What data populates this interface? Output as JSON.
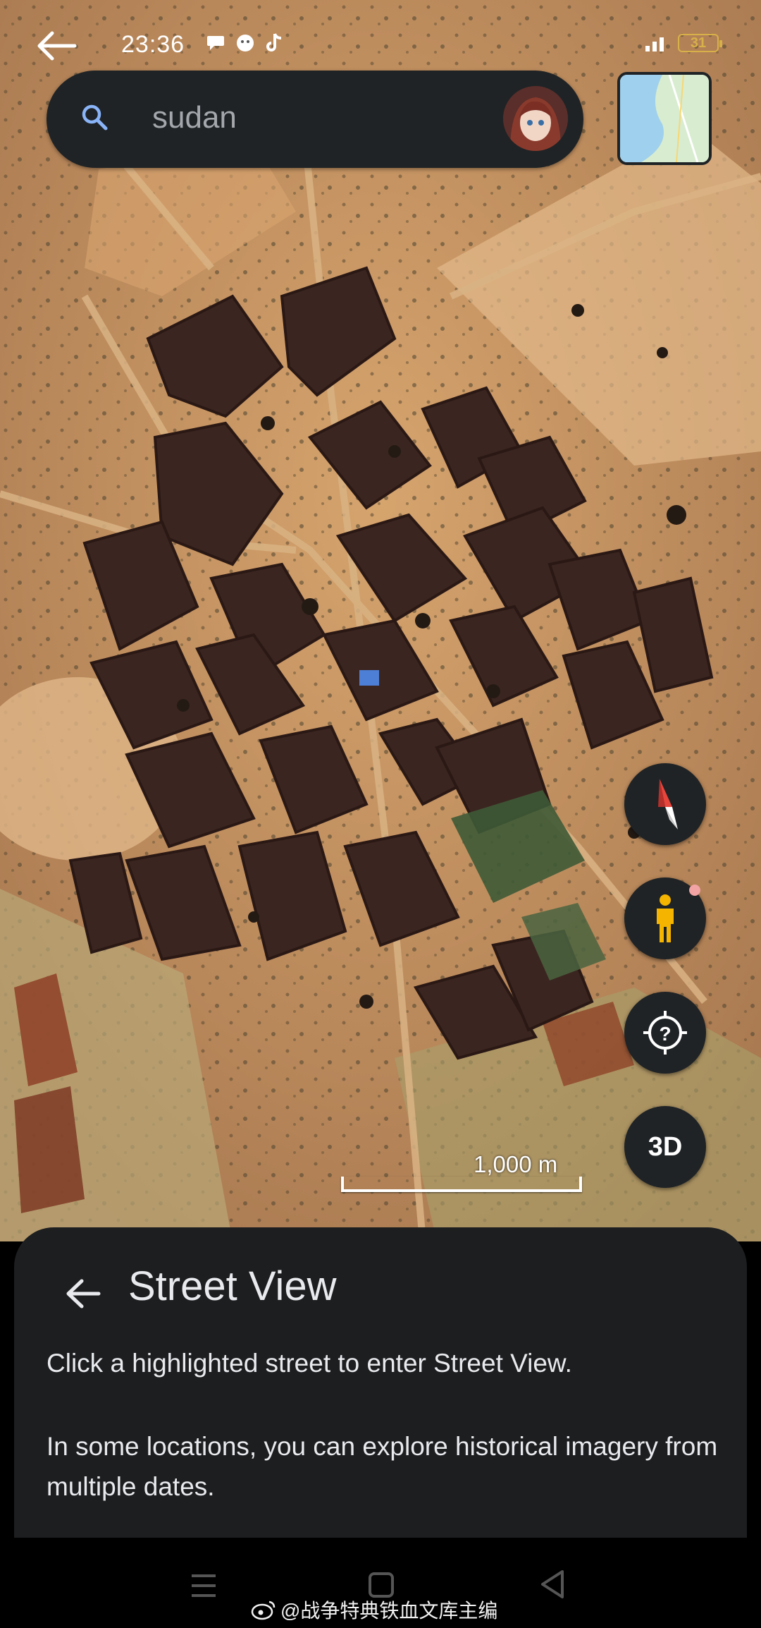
{
  "status_bar": {
    "time": "23:36",
    "battery": "31"
  },
  "search": {
    "query": "sudan"
  },
  "map": {
    "scale_label": "1,000 m",
    "colors": {
      "sand": "#c8935a",
      "dark_compound": "#3a2620",
      "vegetation": "#8a8a4a"
    }
  },
  "controls": {
    "compass": "compass-icon",
    "pegman": "pegman-icon",
    "location": "location-help-icon",
    "three_d_label": "3D"
  },
  "street_view_panel": {
    "title": "Street View",
    "paragraph_1": "Click a highlighted street to enter Street View.",
    "paragraph_2": "In some locations, you can explore historical imagery from multiple dates."
  },
  "watermark": {
    "text": "@战争特典铁血文库主编"
  }
}
